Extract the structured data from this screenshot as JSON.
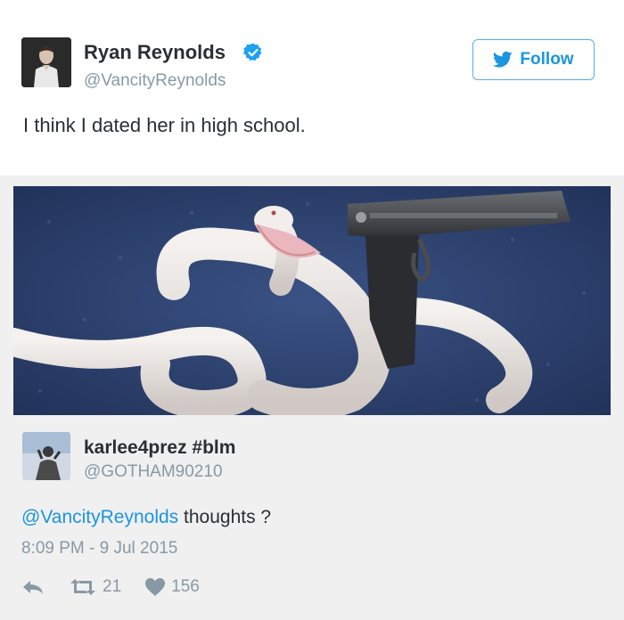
{
  "author": {
    "name": "Ryan Reynolds",
    "handle": "@VancityReynolds",
    "verified": true,
    "avatar_icon": "person-photo"
  },
  "follow_button": {
    "label": "Follow",
    "icon": "twitter-bird-icon"
  },
  "tweet": {
    "text": "I think I dated her in high school."
  },
  "quoted": {
    "image_description_icon": "snake-gun-photo",
    "author": {
      "name": "karlee4prez #blm",
      "handle": "@GOTHAM90210"
    },
    "mention": "@VancityReynolds",
    "text": " thoughts ?",
    "timestamp": "8:09 PM - 9 Jul 2015",
    "retweets": "21",
    "likes": "156"
  },
  "colors": {
    "accent": "#1b95e0",
    "muted": "#8899a6",
    "text": "#292f33",
    "quote_bg": "#f0f0f0"
  }
}
